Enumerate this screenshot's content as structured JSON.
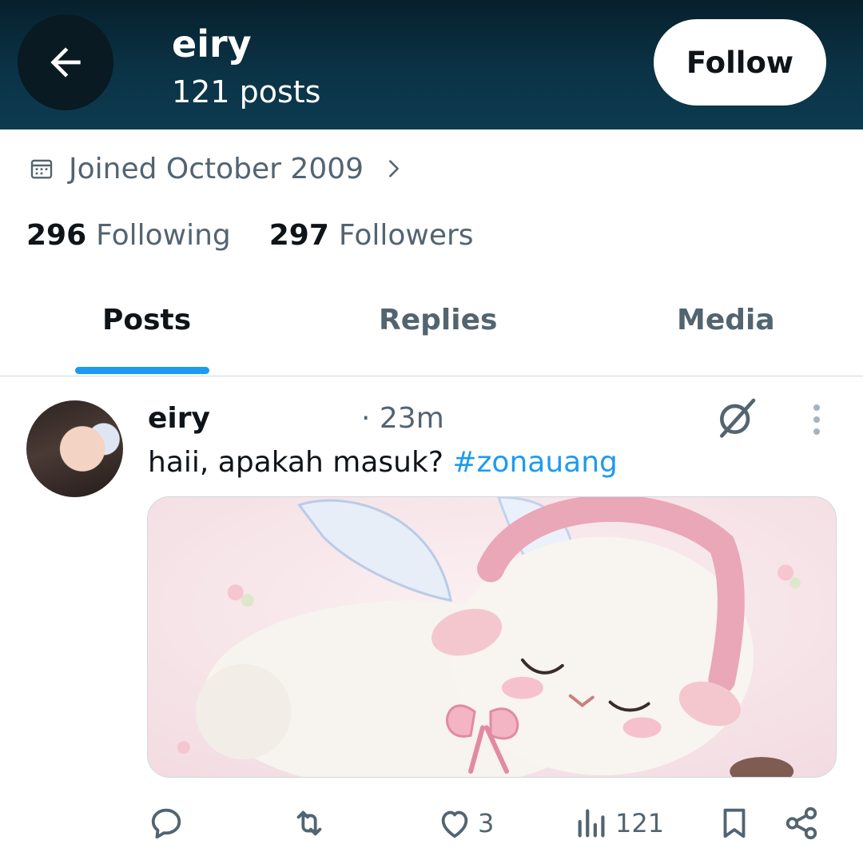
{
  "header": {
    "name": "eiry",
    "posts_count": "121 posts",
    "follow_label": "Follow"
  },
  "profile": {
    "joined": "Joined October 2009",
    "following_count": "296",
    "following_label": "Following",
    "followers_count": "297",
    "followers_label": "Followers"
  },
  "tabs": [
    {
      "label": "Posts",
      "active": true
    },
    {
      "label": "Replies",
      "active": false
    },
    {
      "label": "Media",
      "active": false
    }
  ],
  "post": {
    "author": "eiry",
    "time": "· 23m",
    "text": "haii, apakah masuk? ",
    "hashtag": "#zonauang",
    "likes": "3",
    "views": "121"
  },
  "icons": {
    "back": "arrow-left-icon",
    "calendar": "calendar-icon",
    "chevron": "chevron-right-icon",
    "grok": "grok-icon",
    "more": "more-vertical-icon",
    "reply": "reply-icon",
    "repost": "repost-icon",
    "like": "heart-icon",
    "views": "analytics-icon",
    "bookmark": "bookmark-icon",
    "share": "share-icon"
  },
  "colors": {
    "accent": "#1d9bf0",
    "header_bg": "#0b3346",
    "secondary_text": "#536471"
  }
}
